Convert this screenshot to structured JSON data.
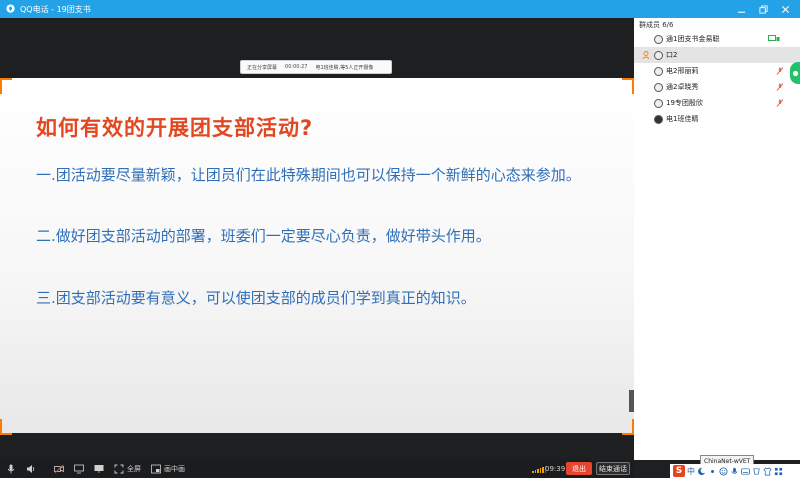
{
  "window": {
    "app_name": "QQ电话",
    "separator": " - ",
    "group_name": "19团支书"
  },
  "share_bar": {
    "status": "正在分享屏幕",
    "timer": "00:00:27",
    "notice": "电1班佳睛,等5人正开摄像"
  },
  "slide": {
    "title": "如何有效的开展团支部活动?",
    "points": [
      "一.团活动要尽量新颖，让团员们在此特殊期间也可以保持一个新鲜的心态来参加。",
      "二.做好团支部活动的部署，班委们一定要尽心负责，做好带头作用。",
      "三.团支部活动要有意义，可以使团支部的成员们学到真正的知识。"
    ]
  },
  "toolbar": {
    "fullscreen_label": "全屏",
    "pip_label": "画中画",
    "call_time": "09:39",
    "exit_label": "退出",
    "end_label": "结束通话",
    "signal_level": 0.8
  },
  "panel": {
    "header": "群成员 6/6",
    "members": [
      {
        "name": "通1团支书金易聪",
        "role": "admin",
        "muted": false,
        "sharing": true
      },
      {
        "name": "口2",
        "role": "owner",
        "muted": false,
        "sharing": false
      },
      {
        "name": "电2邢丽莉",
        "role": "member",
        "muted": true,
        "sharing": false
      },
      {
        "name": "通2卓晓秀",
        "role": "member",
        "muted": true,
        "sharing": false
      },
      {
        "name": "19专团殷欣",
        "role": "member",
        "muted": true,
        "sharing": false
      },
      {
        "name": "电1班佳睛",
        "role": "member",
        "muted": false,
        "sharing": false
      }
    ]
  },
  "tooltip": "ChinaNet-wVET",
  "ime": {
    "logo": "S",
    "mode": "中"
  },
  "colors": {
    "titlebar": "#23a2e8",
    "slide_title": "#e3471f",
    "slide_text": "#2f6fb8",
    "corner_accent": "#ff7a00",
    "exit_button": "#e8452f"
  }
}
